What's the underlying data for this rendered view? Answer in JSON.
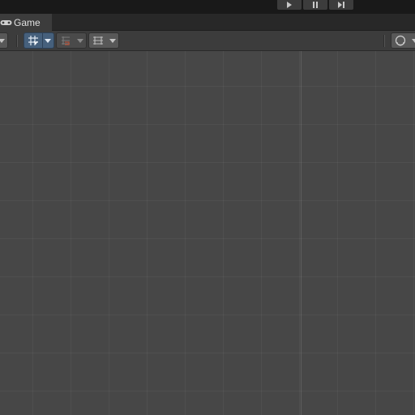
{
  "window": {
    "tab_label": "Game"
  },
  "playbar": {
    "buttons": [
      {
        "name": "play",
        "icon": "play-icon"
      },
      {
        "name": "pause",
        "icon": "pause-icon"
      },
      {
        "name": "step",
        "icon": "step-icon"
      }
    ]
  },
  "toolbar": {
    "buttons": [
      {
        "name": "dropdown-left",
        "icon": "caret-down-icon"
      },
      {
        "name": "gizmo-tool",
        "icon": "grid-snap-icon",
        "active": true
      },
      {
        "name": "render-mode",
        "icon": "layers-icon",
        "active": false
      },
      {
        "name": "grid-visibility",
        "icon": "grid-plane-icon",
        "active": false
      },
      {
        "name": "camera-settings",
        "icon": "camera-sphere-icon",
        "active": false
      }
    ]
  },
  "colors": {
    "background": "#474747",
    "toolbar": "#3c3c3c",
    "tab_bar": "#282828",
    "play_bar": "#191919",
    "active_button": "#46607c"
  }
}
